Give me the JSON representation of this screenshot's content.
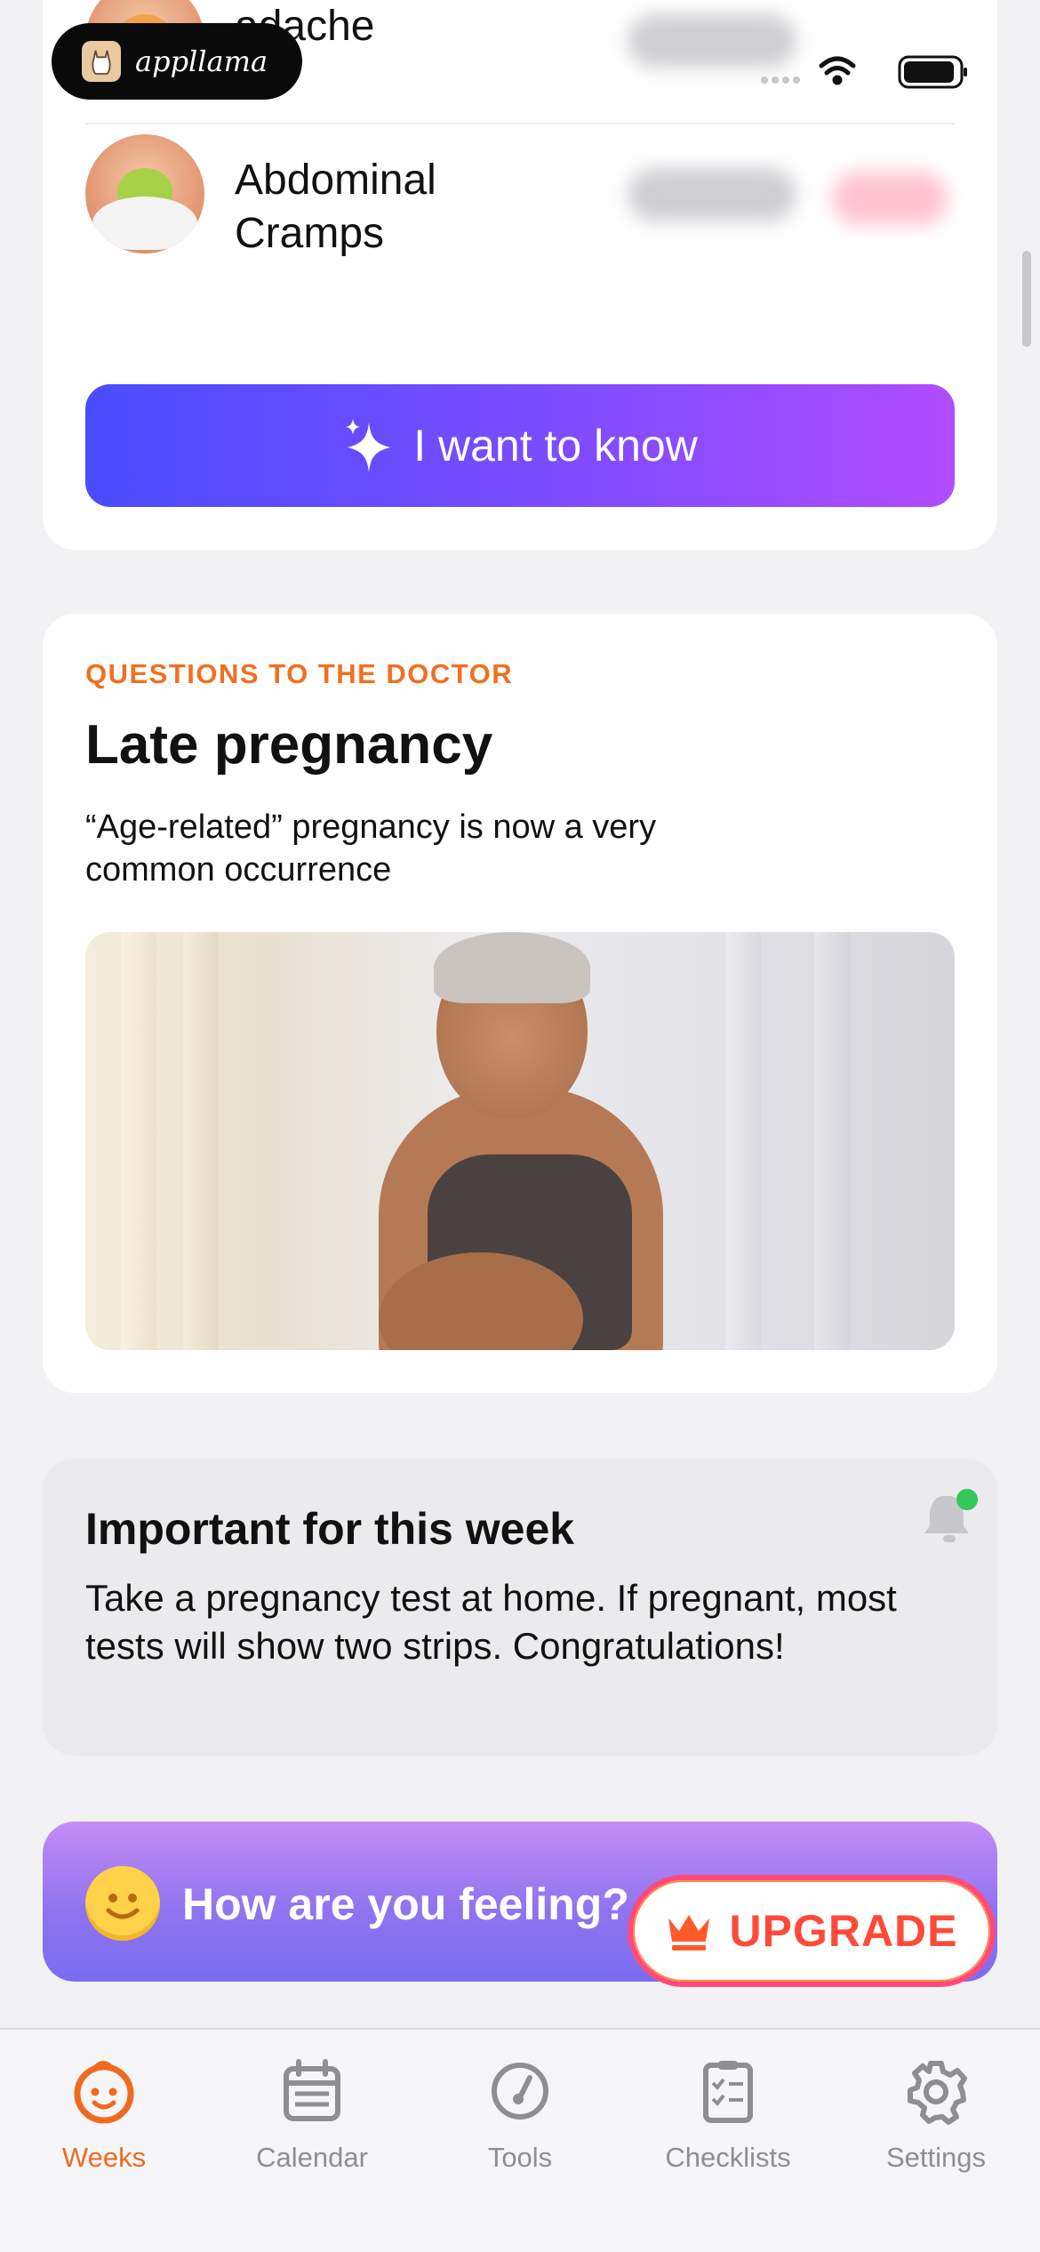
{
  "status_bar": {
    "brand_name": "appllama"
  },
  "symptoms_card": {
    "items": [
      {
        "label": "Headache",
        "visible_label": "adache"
      },
      {
        "label": "Abdominal\nCramps"
      }
    ],
    "button_label": "I want to know"
  },
  "doctor_card": {
    "eyebrow": "QUESTIONS TO THE DOCTOR",
    "title": "Late pregnancy",
    "description": "“Age-related” pregnancy is now a very common occurrence"
  },
  "important_card": {
    "title": "Important for this week",
    "text": "Take a pregnancy test at home. If pregnant, most tests will show two strips. Congratulations!"
  },
  "feeling_banner": {
    "text": "How are you feeling?"
  },
  "upgrade": {
    "label": "UPGRADE"
  },
  "tab_bar": {
    "items": [
      {
        "label": "Weeks",
        "icon": "baby-face-icon",
        "active": true
      },
      {
        "label": "Calendar",
        "icon": "calendar-icon",
        "active": false
      },
      {
        "label": "Tools",
        "icon": "gauge-icon",
        "active": false
      },
      {
        "label": "Checklists",
        "icon": "checklist-icon",
        "active": false
      },
      {
        "label": "Settings",
        "icon": "gear-icon",
        "active": false
      }
    ]
  },
  "colors": {
    "accent_orange": "#f06a1e",
    "button_gradient_start": "#4a4cff",
    "button_gradient_end": "#b04cff",
    "upgrade_red": "#ff4a3a",
    "notification_dot": "#34c759"
  }
}
